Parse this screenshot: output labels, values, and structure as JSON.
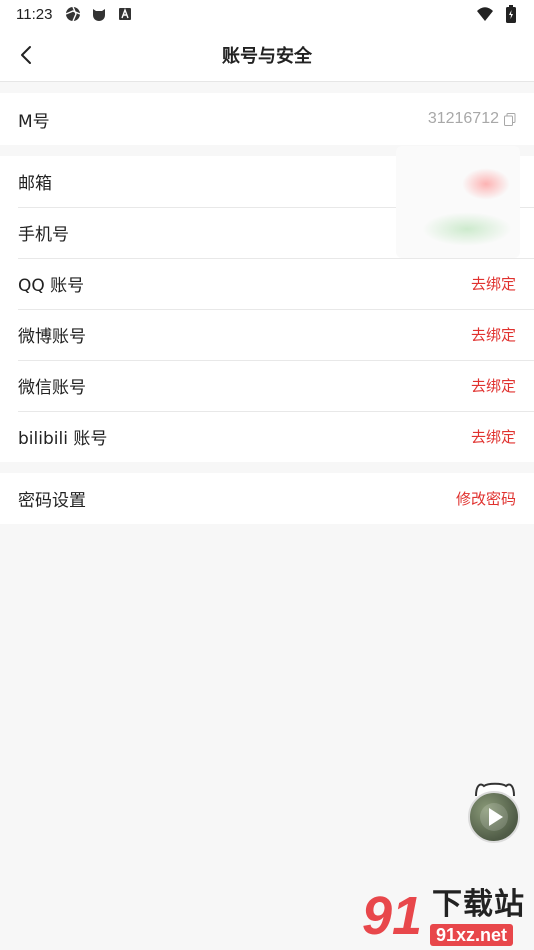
{
  "status_bar": {
    "time": "11:23",
    "left_icons": [
      "aperture-icon",
      "github-icon",
      "a-box-icon"
    ],
    "right_icons": [
      "wifi-icon",
      "battery-icon"
    ]
  },
  "header": {
    "title": "账号与安全",
    "back_icon": "chevron-left-icon"
  },
  "id_section": {
    "label": "M号",
    "value": "31216712",
    "copy_icon": "copy-icon"
  },
  "bind_section": {
    "rows": [
      {
        "label": "邮箱",
        "action": ""
      },
      {
        "label": "手机号",
        "action": ""
      },
      {
        "label": "QQ 账号",
        "action": "去绑定"
      },
      {
        "label": "微博账号",
        "action": "去绑定"
      },
      {
        "label": "微信账号",
        "action": "去绑定"
      },
      {
        "label": "bilibili 账号",
        "action": "去绑定"
      }
    ]
  },
  "password_section": {
    "label": "密码设置",
    "action": "修改密码"
  },
  "float_button": {
    "icon": "play-icon"
  },
  "watermark": {
    "digits": "91",
    "title": "下载站",
    "url": "91xz.net"
  },
  "colors": {
    "accent": "#e0322f",
    "background": "#f7f7f7",
    "card": "#ffffff",
    "muted_text": "#a8a8a8"
  }
}
